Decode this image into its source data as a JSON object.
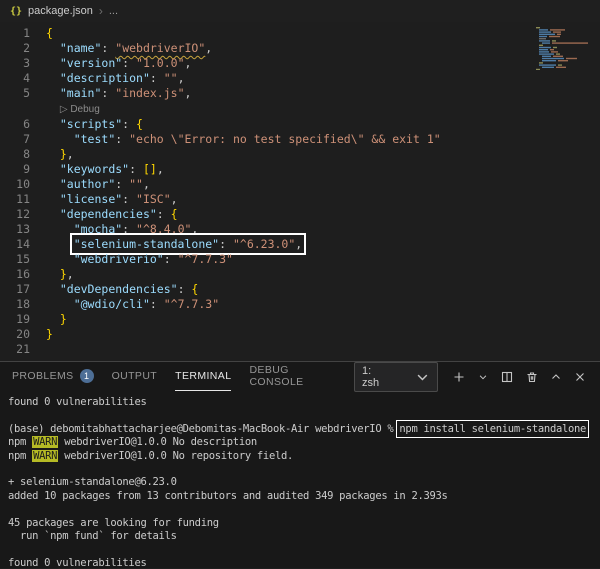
{
  "breadcrumb": {
    "icon": "{}",
    "file": "package.json",
    "separator": "›",
    "more": "..."
  },
  "editor": {
    "lines": [
      {
        "num": "1",
        "tokens": [
          {
            "t": "{",
            "c": "brace"
          }
        ]
      },
      {
        "num": "2",
        "tokens": [
          {
            "t": "  ",
            "c": ""
          },
          {
            "t": "\"name\"",
            "c": "key"
          },
          {
            "t": ": ",
            "c": "punc"
          },
          {
            "t": "\"webdriverIO\"",
            "c": "str squiggle"
          },
          {
            "t": ",",
            "c": "punc"
          }
        ]
      },
      {
        "num": "3",
        "tokens": [
          {
            "t": "  ",
            "c": ""
          },
          {
            "t": "\"version\"",
            "c": "key"
          },
          {
            "t": ": ",
            "c": "punc"
          },
          {
            "t": "\"1.0.0\"",
            "c": "str"
          },
          {
            "t": ",",
            "c": "punc"
          }
        ]
      },
      {
        "num": "4",
        "tokens": [
          {
            "t": "  ",
            "c": ""
          },
          {
            "t": "\"description\"",
            "c": "key"
          },
          {
            "t": ": ",
            "c": "punc"
          },
          {
            "t": "\"\"",
            "c": "str"
          },
          {
            "t": ",",
            "c": "punc"
          }
        ]
      },
      {
        "num": "5",
        "tokens": [
          {
            "t": "  ",
            "c": ""
          },
          {
            "t": "\"main\"",
            "c": "key"
          },
          {
            "t": ": ",
            "c": "punc"
          },
          {
            "t": "\"index.js\"",
            "c": "str"
          },
          {
            "t": ",",
            "c": "punc"
          }
        ]
      },
      {
        "num": "",
        "tokens": [
          {
            "t": "  ",
            "c": ""
          },
          {
            "t": "▷ Debug",
            "c": "codelens"
          }
        ]
      },
      {
        "num": "6",
        "tokens": [
          {
            "t": "  ",
            "c": ""
          },
          {
            "t": "\"scripts\"",
            "c": "key"
          },
          {
            "t": ": ",
            "c": "punc"
          },
          {
            "t": "{",
            "c": "brace"
          }
        ]
      },
      {
        "num": "7",
        "tokens": [
          {
            "t": "    ",
            "c": ""
          },
          {
            "t": "\"test\"",
            "c": "key"
          },
          {
            "t": ": ",
            "c": "punc"
          },
          {
            "t": "\"echo \\\"Error: no test specified\\\" && exit 1\"",
            "c": "str"
          }
        ]
      },
      {
        "num": "8",
        "tokens": [
          {
            "t": "  ",
            "c": ""
          },
          {
            "t": "}",
            "c": "brace"
          },
          {
            "t": ",",
            "c": "punc"
          }
        ]
      },
      {
        "num": "9",
        "tokens": [
          {
            "t": "  ",
            "c": ""
          },
          {
            "t": "\"keywords\"",
            "c": "key"
          },
          {
            "t": ": ",
            "c": "punc"
          },
          {
            "t": "[]",
            "c": "brace"
          },
          {
            "t": ",",
            "c": "punc"
          }
        ]
      },
      {
        "num": "10",
        "tokens": [
          {
            "t": "  ",
            "c": ""
          },
          {
            "t": "\"author\"",
            "c": "key"
          },
          {
            "t": ": ",
            "c": "punc"
          },
          {
            "t": "\"\"",
            "c": "str"
          },
          {
            "t": ",",
            "c": "punc"
          }
        ]
      },
      {
        "num": "11",
        "tokens": [
          {
            "t": "  ",
            "c": ""
          },
          {
            "t": "\"license\"",
            "c": "key"
          },
          {
            "t": ": ",
            "c": "punc"
          },
          {
            "t": "\"ISC\"",
            "c": "str"
          },
          {
            "t": ",",
            "c": "punc"
          }
        ]
      },
      {
        "num": "12",
        "tokens": [
          {
            "t": "  ",
            "c": ""
          },
          {
            "t": "\"dependencies\"",
            "c": "key"
          },
          {
            "t": ": ",
            "c": "punc"
          },
          {
            "t": "{",
            "c": "brace"
          }
        ]
      },
      {
        "num": "13",
        "tokens": [
          {
            "t": "    ",
            "c": ""
          },
          {
            "t": "\"mocha\"",
            "c": "key"
          },
          {
            "t": ": ",
            "c": "punc"
          },
          {
            "t": "\"^8.4.0\"",
            "c": "str"
          },
          {
            "t": ",",
            "c": "punc"
          }
        ]
      },
      {
        "num": "14",
        "boxed": true,
        "tokens": [
          {
            "t": "    ",
            "c": ""
          },
          {
            "t": "\"selenium-standalone\"",
            "c": "key"
          },
          {
            "t": ": ",
            "c": "punc"
          },
          {
            "t": "\"^6.23.0\"",
            "c": "str"
          },
          {
            "t": ",",
            "c": "punc"
          }
        ]
      },
      {
        "num": "15",
        "tokens": [
          {
            "t": "    ",
            "c": ""
          },
          {
            "t": "\"webdriverio\"",
            "c": "key"
          },
          {
            "t": ": ",
            "c": "punc"
          },
          {
            "t": "\"^7.7.3\"",
            "c": "str"
          }
        ]
      },
      {
        "num": "16",
        "tokens": [
          {
            "t": "  ",
            "c": ""
          },
          {
            "t": "}",
            "c": "brace"
          },
          {
            "t": ",",
            "c": "punc"
          }
        ]
      },
      {
        "num": "17",
        "tokens": [
          {
            "t": "  ",
            "c": ""
          },
          {
            "t": "\"devDependencies\"",
            "c": "key"
          },
          {
            "t": ": ",
            "c": "punc"
          },
          {
            "t": "{",
            "c": "brace"
          }
        ]
      },
      {
        "num": "18",
        "tokens": [
          {
            "t": "    ",
            "c": ""
          },
          {
            "t": "\"@wdio/cli\"",
            "c": "key"
          },
          {
            "t": ": ",
            "c": "punc"
          },
          {
            "t": "\"^7.7.3\"",
            "c": "str"
          }
        ]
      },
      {
        "num": "19",
        "tokens": [
          {
            "t": "  ",
            "c": ""
          },
          {
            "t": "}",
            "c": "brace"
          }
        ]
      },
      {
        "num": "20",
        "tokens": [
          {
            "t": "}",
            "c": "brace"
          }
        ]
      },
      {
        "num": "21",
        "tokens": []
      }
    ]
  },
  "panel": {
    "tabs": [
      {
        "label": "PROBLEMS",
        "badge": "1"
      },
      {
        "label": "OUTPUT"
      },
      {
        "label": "TERMINAL",
        "active": true
      },
      {
        "label": "DEBUG CONSOLE"
      }
    ],
    "shell_selector": "1: zsh"
  },
  "terminal": {
    "lines": [
      {
        "segs": [
          {
            "t": "found 0 vulnerabilities",
            "c": ""
          }
        ]
      },
      {
        "segs": []
      },
      {
        "segs": [
          {
            "t": "(base) debomitabhattacharjee@Debomitas-MacBook-Air webdriverIO % ",
            "c": ""
          },
          {
            "t": "npm install selenium-standalone",
            "c": "cmd-box"
          }
        ]
      },
      {
        "segs": [
          {
            "t": "npm ",
            "c": ""
          },
          {
            "t": "WARN",
            "c": "warn"
          },
          {
            "t": " webdriverIO@1.0.0 No description",
            "c": ""
          }
        ]
      },
      {
        "segs": [
          {
            "t": "npm ",
            "c": ""
          },
          {
            "t": "WARN",
            "c": "warn"
          },
          {
            "t": " webdriverIO@1.0.0 No repository field.",
            "c": ""
          }
        ]
      },
      {
        "segs": []
      },
      {
        "segs": [
          {
            "t": "+ selenium-standalone@6.23.0",
            "c": ""
          }
        ]
      },
      {
        "segs": [
          {
            "t": "added 10 packages from 13 contributors and audited 349 packages in 2.393s",
            "c": ""
          }
        ]
      },
      {
        "segs": []
      },
      {
        "segs": [
          {
            "t": "45 packages are looking for funding",
            "c": ""
          }
        ]
      },
      {
        "segs": [
          {
            "t": "  run `npm fund` for details",
            "c": ""
          }
        ]
      },
      {
        "segs": []
      },
      {
        "segs": [
          {
            "t": "found 0 vulnerabilities",
            "c": ""
          }
        ]
      }
    ]
  }
}
